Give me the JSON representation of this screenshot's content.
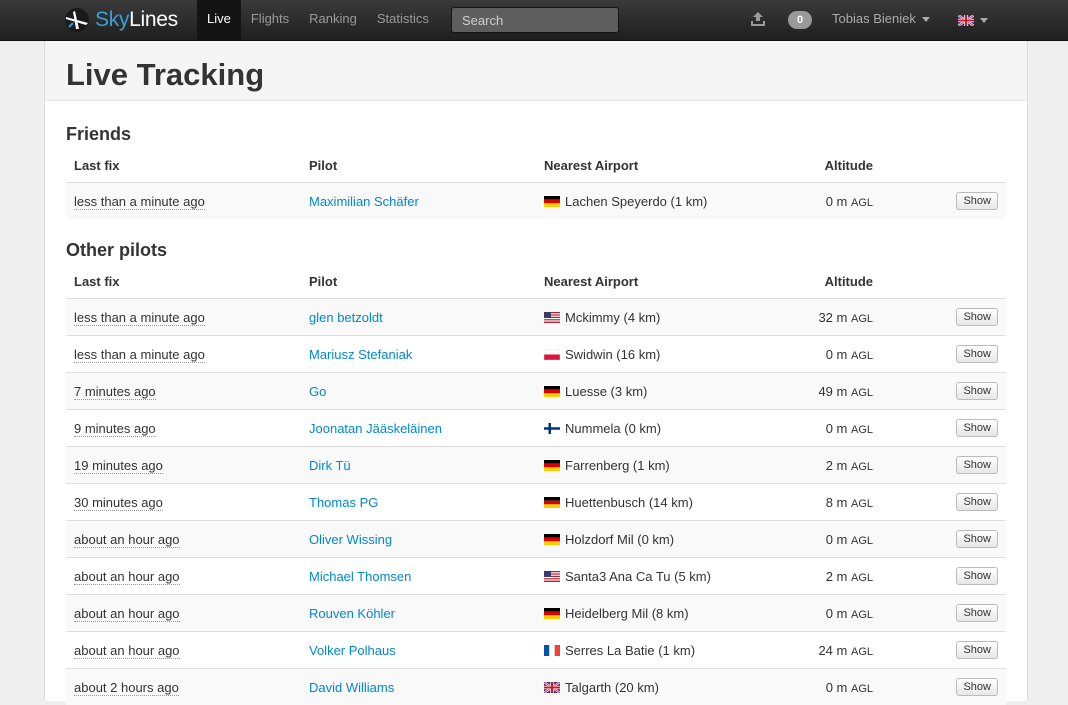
{
  "navbar": {
    "brand_sky": "Sky",
    "brand_lines": "Lines",
    "items": [
      {
        "label": "Live",
        "active": true
      },
      {
        "label": "Flights",
        "active": false
      },
      {
        "label": "Ranking",
        "active": false
      },
      {
        "label": "Statistics",
        "active": false
      }
    ],
    "search_placeholder": "Search",
    "upload_icon": "upload-icon",
    "notifications_count": "0",
    "user_name": "Tobias Bieniek",
    "language_flag": "gb"
  },
  "page": {
    "title": "Live Tracking"
  },
  "columns": {
    "last_fix": "Last fix",
    "pilot": "Pilot",
    "airport": "Nearest Airport",
    "altitude": "Altitude"
  },
  "agl_label": "AGL",
  "show_label": "Show",
  "friends": {
    "title": "Friends",
    "rows": [
      {
        "fix": "less than a minute ago",
        "pilot": "Maximilian Schäfer",
        "flag": "de",
        "airport": "Lachen Speyerdo (1 km)",
        "altitude": "0 m"
      }
    ]
  },
  "others": {
    "title": "Other pilots",
    "rows": [
      {
        "fix": "less than a minute ago",
        "pilot": "glen betzoldt",
        "flag": "us",
        "airport": "Mckimmy (4 km)",
        "altitude": "32 m"
      },
      {
        "fix": "less than a minute ago",
        "pilot": "Mariusz Stefaniak",
        "flag": "pl",
        "airport": "Swidwin (16 km)",
        "altitude": "0 m"
      },
      {
        "fix": "7 minutes ago",
        "pilot": "Go",
        "flag": "de",
        "airport": "Luesse (3 km)",
        "altitude": "49 m"
      },
      {
        "fix": "9 minutes ago",
        "pilot": "Joonatan Jääskeläinen",
        "flag": "fi",
        "airport": "Nummela (0 km)",
        "altitude": "0 m"
      },
      {
        "fix": "19 minutes ago",
        "pilot": "Dirk Tü",
        "flag": "de",
        "airport": "Farrenberg (1 km)",
        "altitude": "2 m"
      },
      {
        "fix": "30 minutes ago",
        "pilot": "Thomas PG",
        "flag": "de",
        "airport": "Huettenbusch (14 km)",
        "altitude": "8 m"
      },
      {
        "fix": "about an hour ago",
        "pilot": "Oliver Wissing",
        "flag": "de",
        "airport": "Holzdorf Mil (0 km)",
        "altitude": "0 m"
      },
      {
        "fix": "about an hour ago",
        "pilot": "Michael Thomsen",
        "flag": "us",
        "airport": "Santa3 Ana Ca Tu (5 km)",
        "altitude": "2 m"
      },
      {
        "fix": "about an hour ago",
        "pilot": "Rouven Köhler",
        "flag": "de",
        "airport": "Heidelberg Mil (8 km)",
        "altitude": "0 m"
      },
      {
        "fix": "about an hour ago",
        "pilot": "Volker Polhaus",
        "flag": "fr",
        "airport": "Serres La Batie (1 km)",
        "altitude": "24 m"
      },
      {
        "fix": "about 2 hours ago",
        "pilot": "David Williams",
        "flag": "gb",
        "airport": "Talgarth (20 km)",
        "altitude": "0 m"
      }
    ]
  }
}
